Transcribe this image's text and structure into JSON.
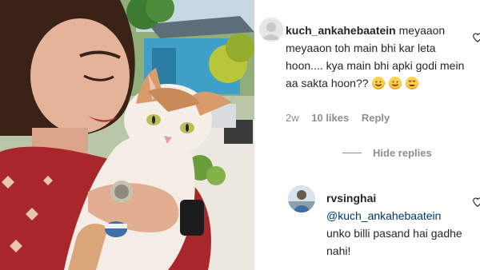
{
  "post_image": {
    "description_icon": "woman-with-cat-photo"
  },
  "comment": {
    "username": "kuch_ankahebaatein",
    "text": "meyaaon meyaaon toh main bhi kar leta hoon.... kya main bhi apki godi mein aa sakta hoon??",
    "emojis": [
      "yum-face-emoji",
      "yum-face-emoji",
      "heart-eyes-emoji"
    ],
    "time": "2w",
    "likes": "10 likes",
    "reply_label": "Reply"
  },
  "hide_replies_label": "Hide replies",
  "reply": {
    "username": "rvsinghai",
    "mention": "@kuch_ankahebaatein",
    "text": "unko billi pasand hai gadhe nahi!"
  },
  "colors": {
    "text": "#262626",
    "meta": "#8e8e8e",
    "mention": "#00376b"
  }
}
